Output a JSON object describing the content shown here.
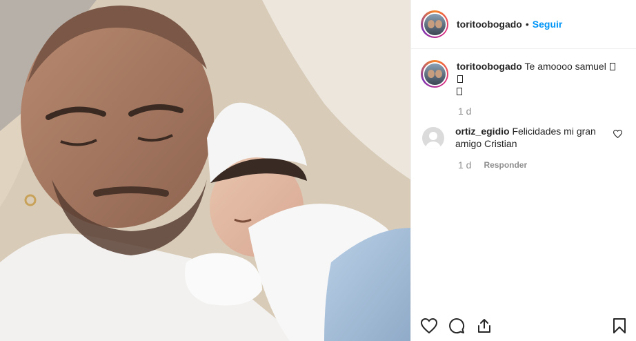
{
  "post": {
    "photo_alt": "photo",
    "author": "toritoobogado",
    "separator": "•",
    "follow_label": "Seguir"
  },
  "caption": {
    "username": "toritoobogado",
    "text": "Te amoooo samuel",
    "time": "1 d"
  },
  "comments": [
    {
      "username": "ortiz_egidio",
      "text": "Felicidades mi gran amigo Cristian",
      "time": "1 d",
      "reply_label": "Responder"
    }
  ],
  "icons": {
    "like": "heart-icon",
    "comment": "comment-icon",
    "share": "share-icon",
    "save": "bookmark-icon"
  }
}
